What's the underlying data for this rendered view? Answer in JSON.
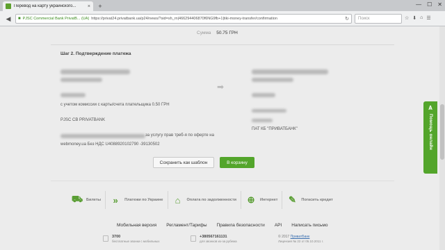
{
  "browser": {
    "tab_title": "Перевод на карту украинского...",
    "tab_close": "×",
    "new_tab": "+",
    "window_controls": [
      "—",
      "☐",
      "✕"
    ],
    "url_identity": "PJSC Commercial Bank PrivatB... (UA)",
    "url_path": "https://privat24.privatbank.ua/p24/news/?sid=sh_rn|466294406870f6NG9fb+1|tiki-money-transfer/confirmation",
    "search_placeholder": "Поиск",
    "nav_back": "◀",
    "reload": "↻"
  },
  "summary": {
    "sum_label": "Сумма",
    "sum_value": "50.75 ГРН"
  },
  "step": {
    "title": "Шаг 2. Подтверждение платежа"
  },
  "sender": {
    "commission": "с учетом комиссии с карты/счета плательщика 0.50 ГРН",
    "bank": "PJSC CB PRIVATBANK",
    "offer": "за услугу прав треб-я по оферте на",
    "details": "webmoney.ua Без НДС U408892010279​0 -39130502"
  },
  "recipient": {
    "bank": "ПАТ КБ \"ПРИВАТБАНК\""
  },
  "actions": {
    "save_template": "Сохранить как шаблон",
    "to_cart": "В корзину"
  },
  "categories": [
    {
      "icon": "tickets-icon",
      "glyph": "⛟",
      "label": "Билеты"
    },
    {
      "icon": "payments-ukraine-icon",
      "glyph": "»",
      "label": "Платежи по Украине"
    },
    {
      "icon": "debt-payment-icon",
      "glyph": "⌂",
      "label": "Оплата по задолженности"
    },
    {
      "icon": "internet-icon",
      "glyph": "⊕",
      "label": "Интернет"
    },
    {
      "icon": "credit-icon",
      "glyph": "✎",
      "label": "Погасить кредит"
    }
  ],
  "footer": {
    "links": [
      "Мобильная версия",
      "Регламент/Тарифы",
      "Правила безопасности",
      "API",
      "Написать письмо"
    ],
    "phone_short": "3700",
    "phone_short_sub": "бесплатные звонки с мобильных",
    "phone_long": "+380567161131",
    "phone_long_sub": "для звонков из-за рубежа",
    "copyright_prefix": "© 2017",
    "copyright_link": "ПриватБанк",
    "license": "Лицензия № 22 от 05.10.2011 г."
  },
  "feedback": {
    "label": "Помощь онлайн"
  },
  "colors": {
    "accent": "#53a52b",
    "background": "#ececec"
  }
}
